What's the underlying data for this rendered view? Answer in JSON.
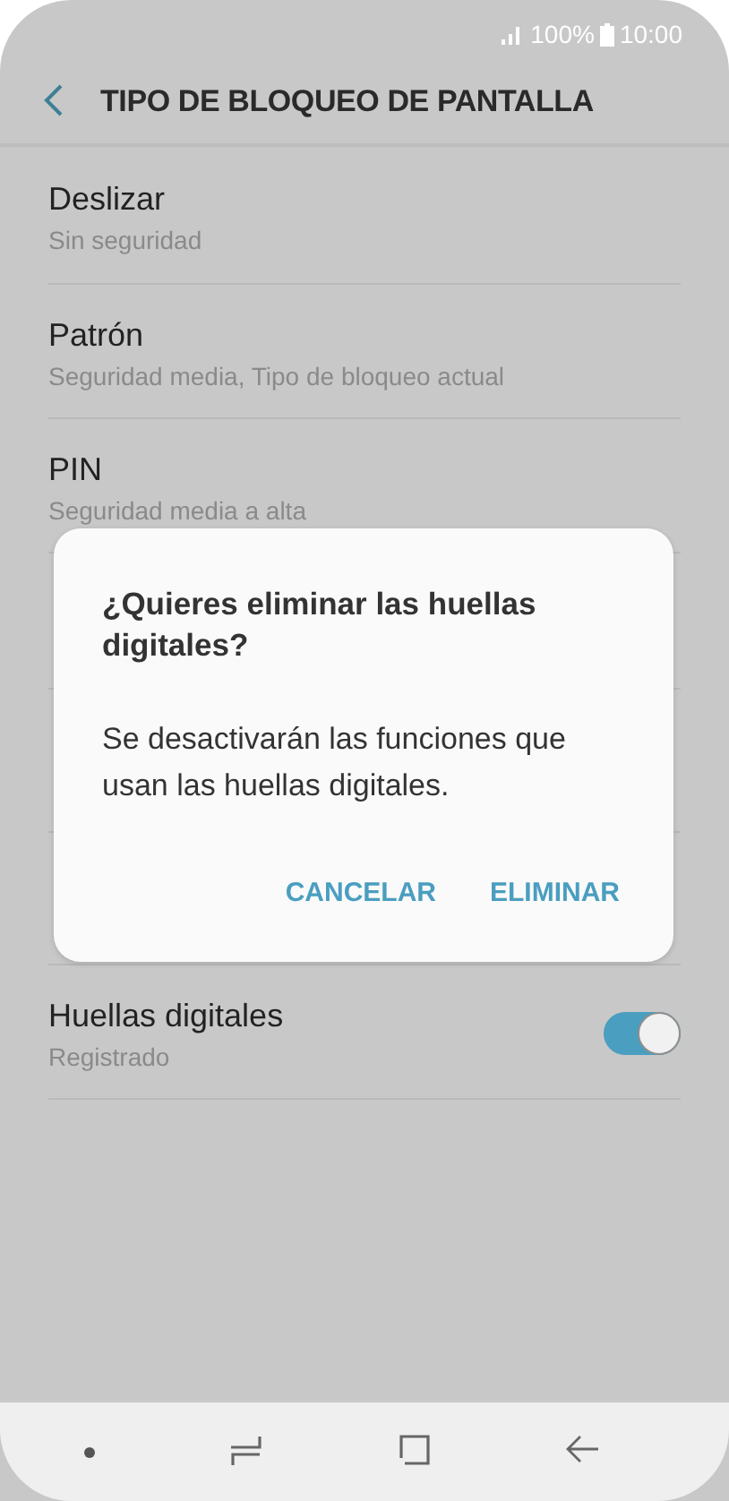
{
  "status_bar": {
    "battery": "100%",
    "time": "10:00"
  },
  "header": {
    "title": "TIPO DE BLOQUEO DE PANTALLA"
  },
  "rows": [
    {
      "title": "Deslizar",
      "subtitle": "Sin seguridad",
      "kind": "text"
    },
    {
      "title": "Patrón",
      "subtitle": "Seguridad media, Tipo de bloqueo actual",
      "kind": "text"
    },
    {
      "title": "PIN",
      "subtitle": "Seguridad media a alta",
      "kind": "text"
    },
    {
      "title": "Huellas digitales",
      "subtitle": "Registrado",
      "kind": "toggle",
      "on": true
    }
  ],
  "dialog": {
    "title": "¿Quieres eliminar las huellas digitales?",
    "message": "Se desactivarán las funciones que usan las huellas digitales.",
    "buttons": [
      "CANCELAR",
      "ELIMINAR"
    ]
  }
}
